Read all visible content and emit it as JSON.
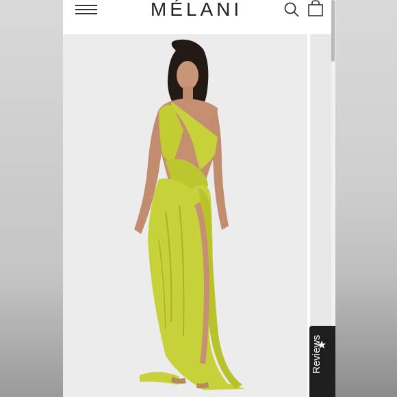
{
  "header": {
    "brand": "MÉLANI",
    "menu_icon": "hamburger-menu-icon",
    "search_icon": "search-icon",
    "bag_icon": "shopping-bag-icon"
  },
  "product": {
    "image_subject": "model in one-shoulder draped lime gown with thigh-high slit",
    "dress_color": "#c7d23a",
    "background_color": "#ececec"
  },
  "reviews_tab": {
    "label": "Reviews",
    "icon": "star-icon"
  }
}
